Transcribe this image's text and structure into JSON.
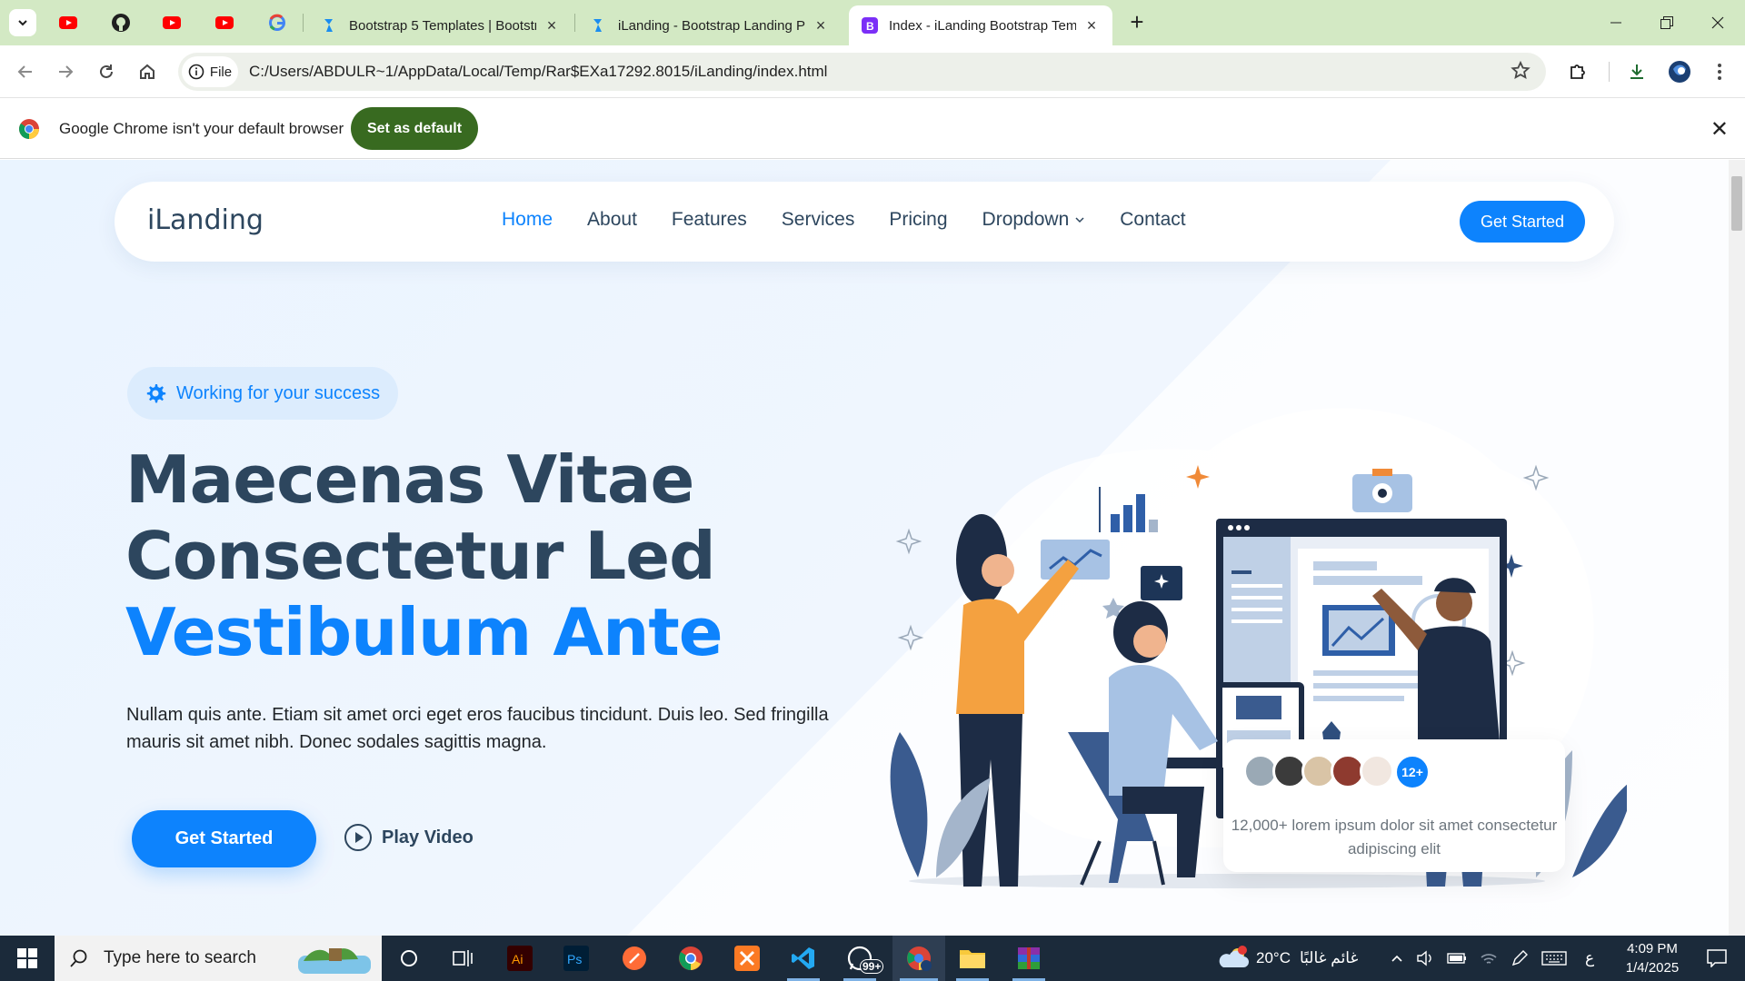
{
  "browser": {
    "tabs": [
      {
        "title": "Bootstrap 5 Templates | Bootstr",
        "active": false
      },
      {
        "title": "iLanding - Bootstrap Landing Pa",
        "active": false
      },
      {
        "title": "Index - iLanding Bootstrap Tem",
        "active": true
      }
    ],
    "omnibox": {
      "chip": "File",
      "url": "C:/Users/ABDULR~1/AppData/Local/Temp/Rar$EXa17292.8015/iLanding/index.html"
    },
    "infobar": {
      "message": "Google Chrome isn't your default browser",
      "button": "Set as default"
    }
  },
  "site": {
    "logo": "iLanding",
    "nav": [
      "Home",
      "About",
      "Features",
      "Services",
      "Pricing",
      "Dropdown",
      "Contact"
    ],
    "nav_active": "Home",
    "nav_cta": "Get Started",
    "hero": {
      "badge": "Working for your success",
      "title_line1": "Maecenas Vitae",
      "title_line2": "Consectetur Led",
      "title_line3": "Vestibulum Ante",
      "lead": "Nullam quis ante. Etiam sit amet orci eget eros faucibus tincidunt. Duis leo. Sed fringilla mauris sit amet nibh. Donec sodales sagittis magna.",
      "cta": "Get Started",
      "play": "Play Video"
    },
    "customers_card": {
      "count_badge": "12+",
      "text": "12,000+ lorem ipsum dolor sit amet consectetur adipiscing elit"
    }
  },
  "taskbar": {
    "search_placeholder": "Type here to search",
    "whatsapp_badge": "99+",
    "weather_temp": "20°C",
    "weather_text": "غائم غالبًا",
    "lang": "ع",
    "time": "4:09 PM",
    "date": "1/4/2025"
  },
  "colors": {
    "accent": "#0d83fd",
    "heading": "#2d465e",
    "tabstrip": "#d3e9c4",
    "set_default": "#386a20"
  }
}
